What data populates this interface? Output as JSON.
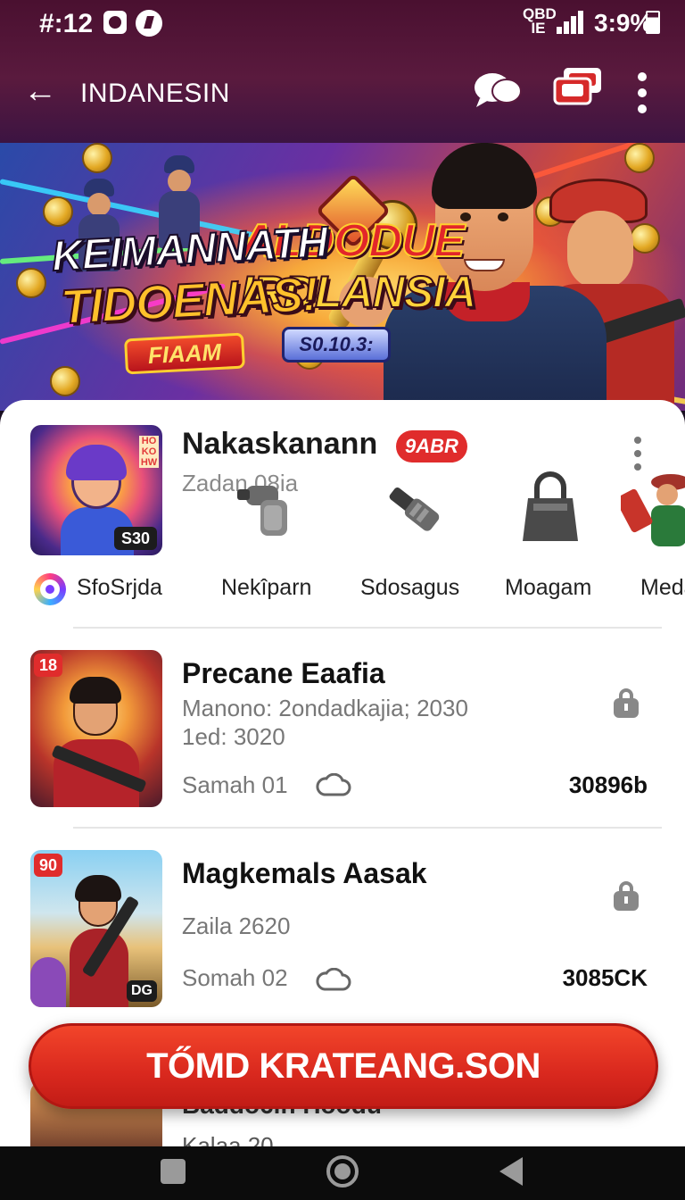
{
  "status_bar": {
    "time": "#:12",
    "signal_text": "QBD\n  IE",
    "battery": "3:9%"
  },
  "header": {
    "title": "INDANESIN",
    "logo_line1": "ALDODUE",
    "logo_line2": "IRDLANSIA",
    "logo_chip": "S0.10.3:"
  },
  "banner": {
    "headline1": "KEIMANNATH",
    "headline2": "TIDOENAS!",
    "tag": "FIAAM"
  },
  "featured": {
    "title": "Nakaskanann",
    "tag": "9ABR",
    "subtitle": "Zadan 08ia",
    "thumb_badge": "S30",
    "thumb_side_text": "HO KO HW",
    "chips": [
      {
        "label": "SfoSrjda"
      },
      {
        "label": "Nekîparn"
      },
      {
        "label": "Sdosagus"
      },
      {
        "label": "Moagam"
      },
      {
        "label": "Meda"
      }
    ]
  },
  "list": [
    {
      "num": "18",
      "title": "Precane Eaafia",
      "line1": "Manono: 2ondadkajia; 2030",
      "line2": "1ed: 3020",
      "meta": "Samah 01",
      "count": "30896b",
      "corner": ""
    },
    {
      "num": "90",
      "title": "Magkemals Aasak",
      "line1": "Zaila 2620",
      "line2": "",
      "meta": "Somah 02",
      "count": "3085CK",
      "corner": "DG"
    }
  ],
  "peek": {
    "line1": "Baddo6ln Hoodu",
    "line2": "Kalaa 20"
  },
  "cta": {
    "label": "TŐMD KRATEANG.SON"
  },
  "colors": {
    "accent": "#e02c2c",
    "header_bg": "#4a1030",
    "cta": "#d9281e"
  }
}
